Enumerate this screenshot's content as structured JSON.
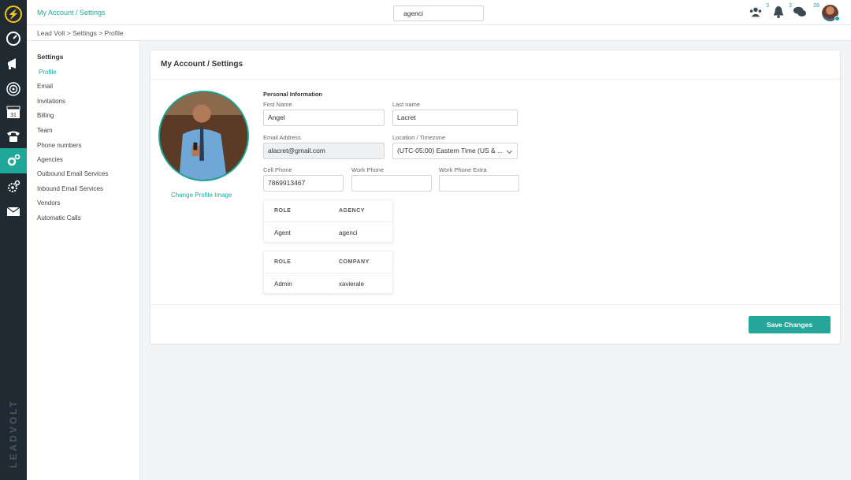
{
  "app": {
    "page_title": "My Account / Settings",
    "search_value": "agenci",
    "notifications": {
      "team_count": "3",
      "bell_count": "3",
      "chat_count": "28"
    },
    "brand_vertical": "LEADVOLT",
    "accent_color": "#1fa79a"
  },
  "breadcrumb": {
    "text": "Lead Volt  >  Settings > Profile"
  },
  "sidebar": {
    "heading": "Settings",
    "items": [
      {
        "label": "Profile",
        "active": true
      },
      {
        "label": "Email"
      },
      {
        "label": "Invitations"
      },
      {
        "label": "Billing"
      },
      {
        "label": "Team"
      },
      {
        "label": "Phone numbers"
      },
      {
        "label": "Agencies"
      },
      {
        "label": "Outbound Email Services"
      },
      {
        "label": "Inbound Email Services"
      },
      {
        "label": "Vendors"
      },
      {
        "label": "Automatic Calls"
      }
    ]
  },
  "rail_icons": [
    "lightning-logo-icon",
    "dashboard-gauge-icon",
    "megaphone-icon",
    "target-icon",
    "calendar-icon",
    "phone-icon",
    "gears-icon",
    "settings-cog-icon",
    "envelope-icon"
  ],
  "card": {
    "title": "My Account / Settings",
    "change_image_label": "Change Profile Image",
    "section_label": "Personal Information",
    "fields": {
      "first_name": {
        "label": "First Name",
        "value": "Angel"
      },
      "last_name": {
        "label": "Last name",
        "value": "Lacret"
      },
      "email": {
        "label": "Email Address",
        "value": "alacret@gmail.com"
      },
      "timezone": {
        "label": "Location / Timezone",
        "value": "(UTC-05:00) Eastern Time (US & ..."
      },
      "cell_phone": {
        "label": "Cell Phone",
        "value": "7869913467"
      },
      "work_phone": {
        "label": "Work Phone",
        "value": ""
      },
      "work_phone_extra": {
        "label": "Work Phone Extra",
        "value": ""
      }
    },
    "roles_table": {
      "headers": [
        "ROLE",
        "AGENCY"
      ],
      "row": [
        "Agent",
        "agenci"
      ]
    },
    "company_table": {
      "headers": [
        "ROLE",
        "COMPANY"
      ],
      "row": [
        "Admin",
        "xavierale"
      ]
    },
    "save_label": "Save Changes"
  }
}
